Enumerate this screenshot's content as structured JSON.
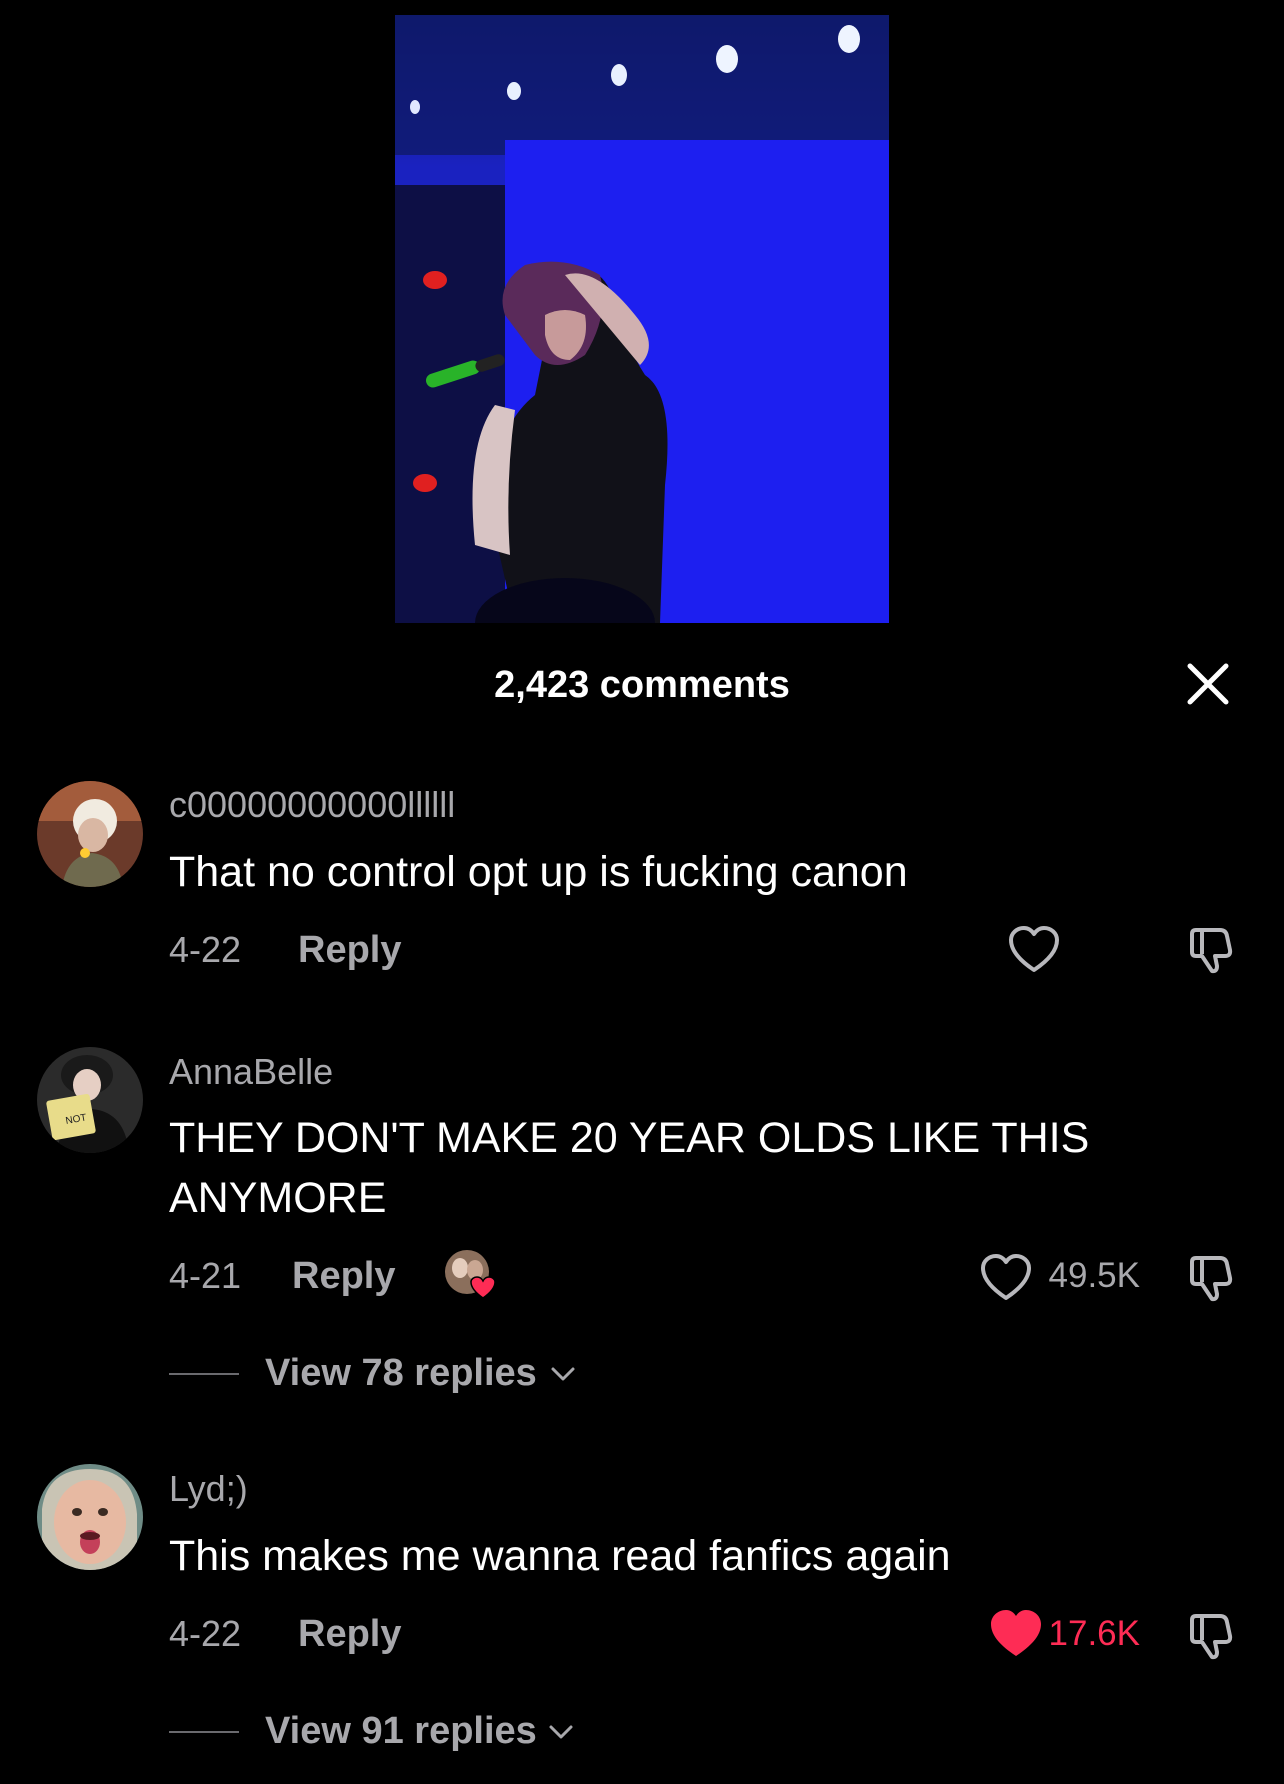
{
  "header": {
    "comments_count": "2,423 comments"
  },
  "comments": [
    {
      "username": "c00000000000llllll",
      "text": "That no control opt up is fucking canon",
      "date": "4-22",
      "reply_label": "Reply",
      "like_count": "",
      "liked": false
    },
    {
      "username": "AnnaBelle",
      "text": "THEY DON'T MAKE 20 YEAR OLDS LIKE THIS ANYMORE",
      "date": "4-21",
      "reply_label": "Reply",
      "like_count": "49.5K",
      "liked": false,
      "liked_by_creator": true,
      "view_replies": "View 78 replies"
    },
    {
      "username": "Lyd;)",
      "text": "This makes me wanna read fanfics again",
      "date": "4-22",
      "reply_label": "Reply",
      "like_count": "17.6K",
      "liked": true,
      "view_replies": "View 91 replies"
    }
  ],
  "colors": {
    "background": "#000000",
    "muted_text": "#a8a8ac",
    "liked_heart": "#fe2c55",
    "video_blue": "#1a1ec8"
  },
  "icons": [
    "close-icon",
    "heart-icon",
    "heart-filled-icon",
    "dislike-icon",
    "chevron-down-icon"
  ]
}
